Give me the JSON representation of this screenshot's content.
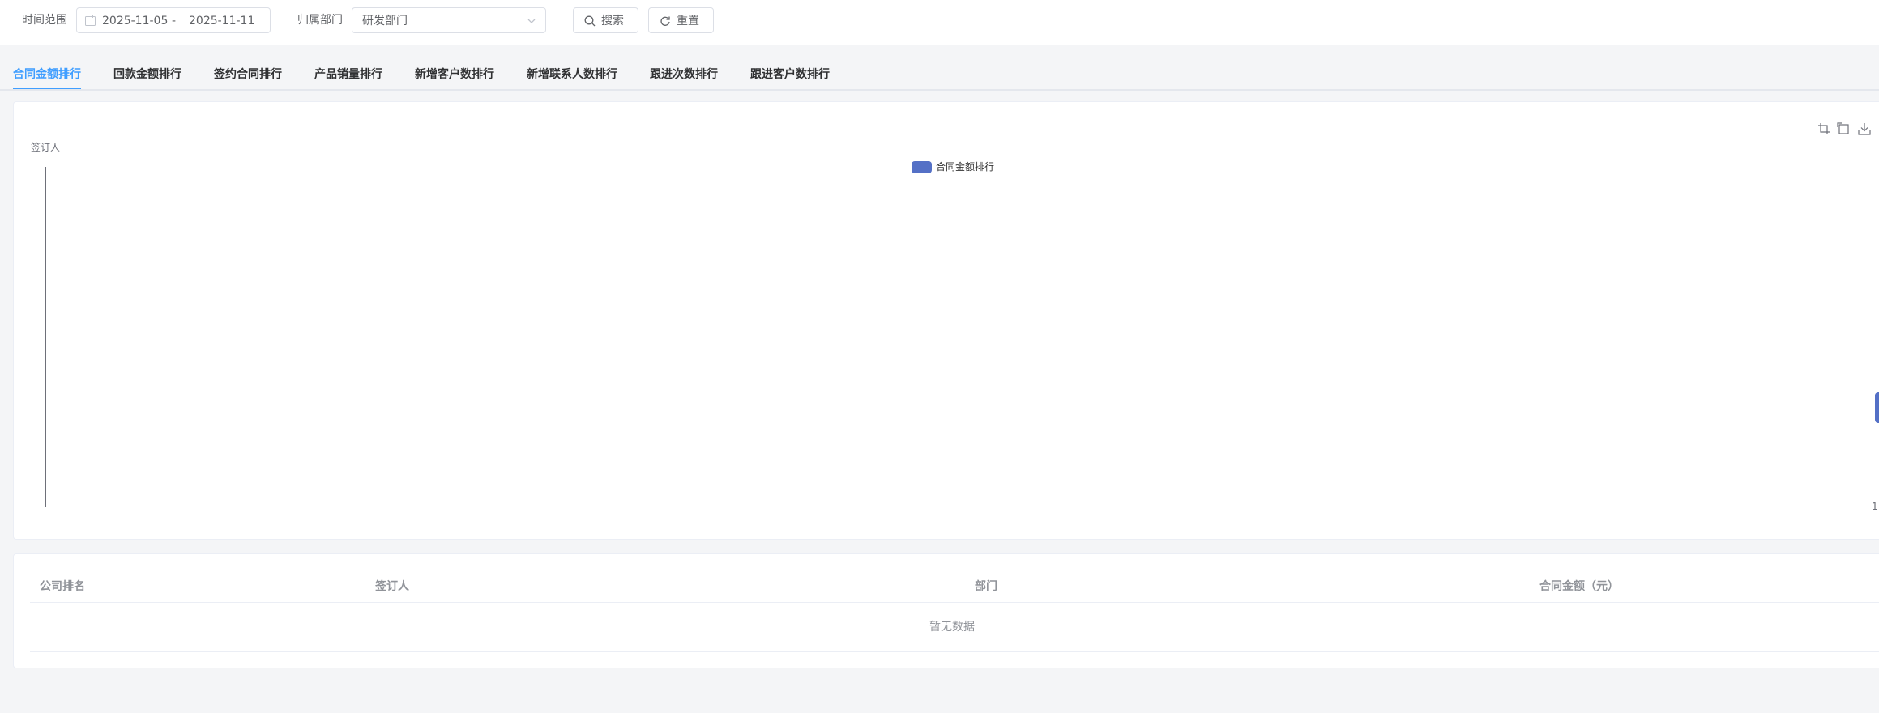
{
  "filters": {
    "time_range_label": "时间范围",
    "date_start": "2025-11-05",
    "date_separator": "-",
    "date_end": "2025-11-11",
    "department_label": "归属部门",
    "department_value": "研发部门",
    "search_button": "搜索",
    "reset_button": "重置"
  },
  "tabs": [
    {
      "label": "合同金额排行",
      "active": true
    },
    {
      "label": "回款金额排行",
      "active": false
    },
    {
      "label": "签约合同排行",
      "active": false
    },
    {
      "label": "产品销量排行",
      "active": false
    },
    {
      "label": "新增客户数排行",
      "active": false
    },
    {
      "label": "新增联系人数排行",
      "active": false
    },
    {
      "label": "跟进次数排行",
      "active": false
    },
    {
      "label": "跟进客户数排行",
      "active": false
    }
  ],
  "chart_data": {
    "type": "bar",
    "ylabel": "签订人",
    "legend": [
      "合同金额排行"
    ],
    "legend_position": "top-center",
    "series": [
      {
        "name": "合同金额排行",
        "values": []
      }
    ],
    "categories": [],
    "x_ticks": [
      "1"
    ],
    "color": "#5470c6",
    "toolbox": [
      "data-zoom-icon",
      "zoom-reset-icon",
      "save-image-icon"
    ]
  },
  "table": {
    "columns": [
      "公司排名",
      "签订人",
      "部门",
      "合同金额（元）"
    ],
    "rows": [],
    "empty_text": "暂无数据"
  },
  "colors": {
    "accent": "#409eff",
    "series": "#5470c6",
    "page_background": "#f4f5f7"
  }
}
